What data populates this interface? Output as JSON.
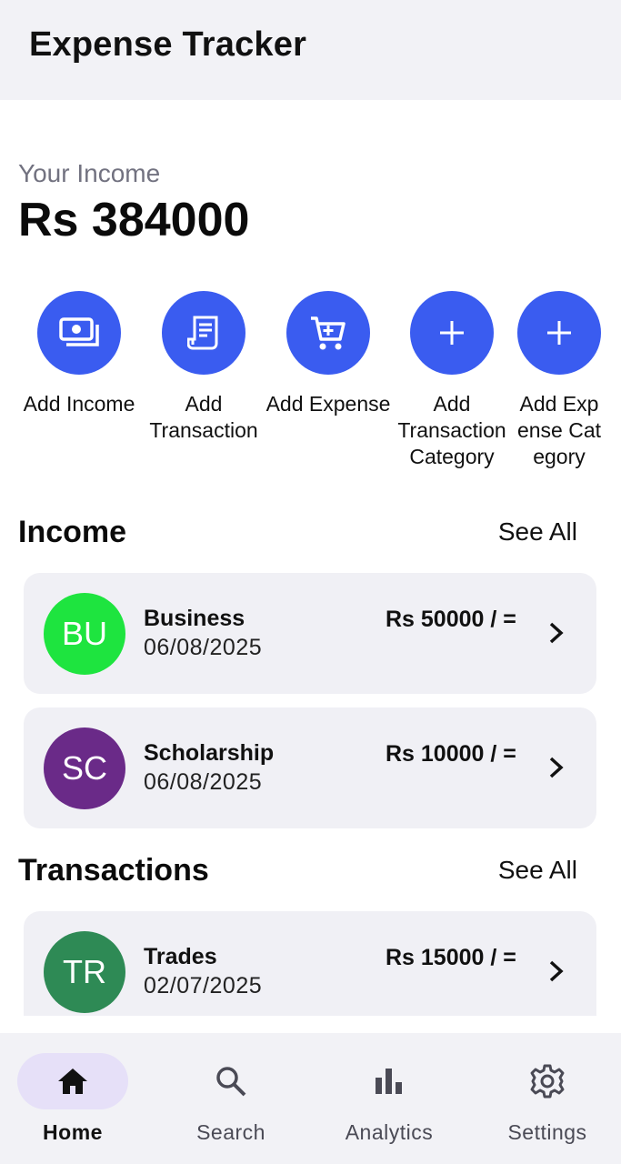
{
  "appbar": {
    "title": "Expense Tracker"
  },
  "summary": {
    "label": "Your Income",
    "amount": "Rs 384000"
  },
  "actions": [
    {
      "icon": "money-icon",
      "label": "Add Income"
    },
    {
      "icon": "receipt-icon",
      "label": "Add Transaction"
    },
    {
      "icon": "cart-icon",
      "label": "Add Expense"
    },
    {
      "icon": "plus-icon",
      "label": "Add Transaction Category"
    },
    {
      "icon": "plus-icon",
      "label": "Add Expense Category"
    }
  ],
  "income": {
    "title": "Income",
    "see_all": "See All",
    "items": [
      {
        "initials": "BU",
        "name": "Business",
        "date": "06/08/2025",
        "amount": "Rs 50000 / =",
        "color": "#1ee43f"
      },
      {
        "initials": "SC",
        "name": "Scholarship",
        "date": "06/08/2025",
        "amount": "Rs 10000 / =",
        "color": "#6a2a88"
      }
    ]
  },
  "transactions": {
    "title": "Transactions",
    "see_all": "See All",
    "items": [
      {
        "initials": "TR",
        "name": "Trades",
        "date": "02/07/2025",
        "amount": "Rs 15000 / =",
        "color": "#2e8a55"
      }
    ]
  },
  "nav": {
    "items": [
      {
        "icon": "home-icon",
        "label": "Home",
        "active": true
      },
      {
        "icon": "search-icon",
        "label": "Search",
        "active": false
      },
      {
        "icon": "bar-chart-icon",
        "label": "Analytics",
        "active": false
      },
      {
        "icon": "gear-icon",
        "label": "Settings",
        "active": false
      }
    ]
  },
  "colors": {
    "accent": "#3a5cf0",
    "active_pill": "#e6e0f8",
    "surface": "#f0f0f5"
  }
}
